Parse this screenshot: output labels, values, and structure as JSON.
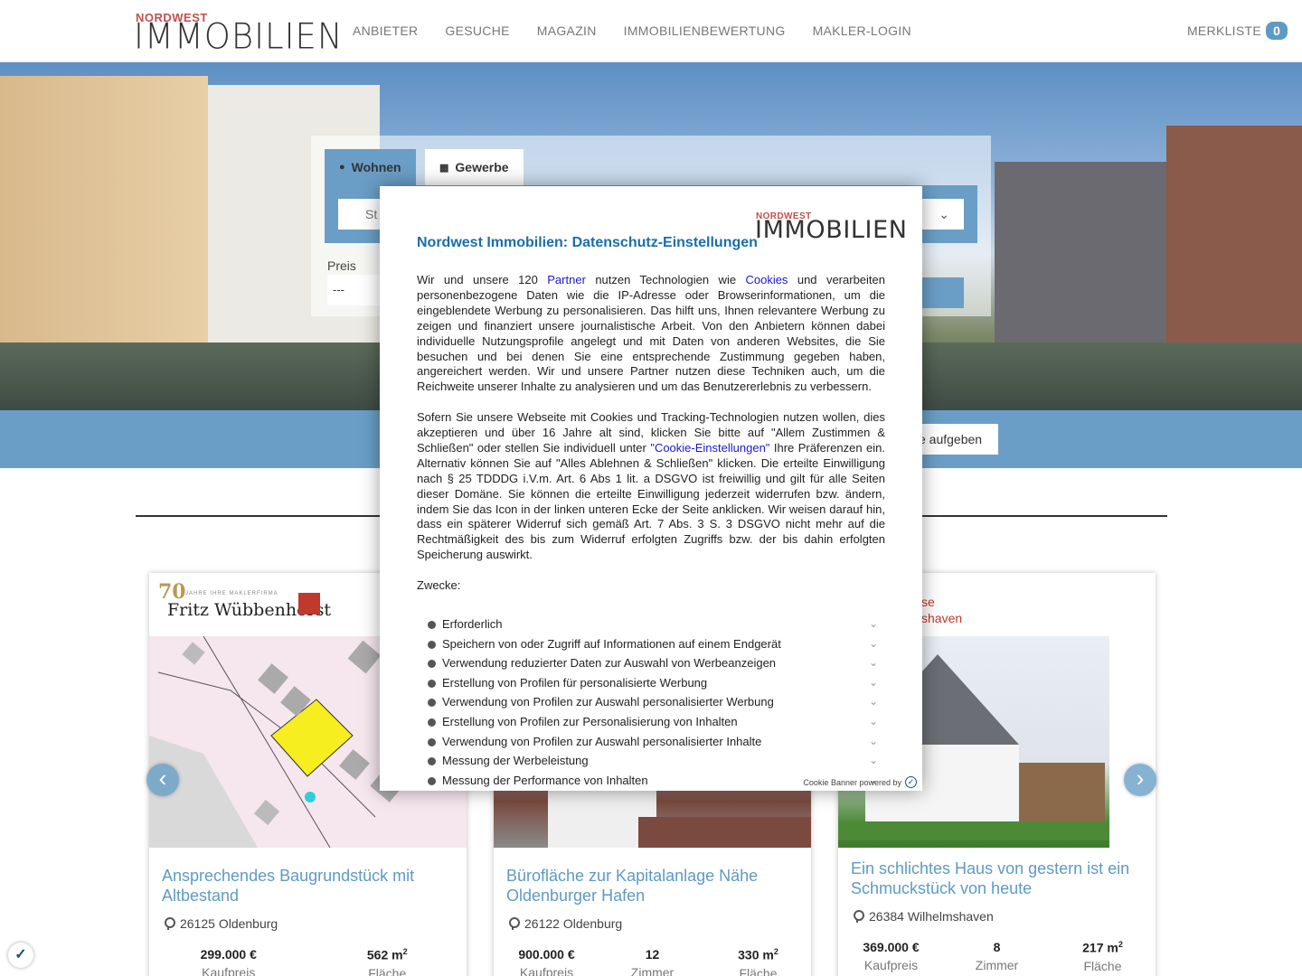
{
  "header": {
    "logo_top": "NORDWEST",
    "logo_main": "IMMOBILIEN",
    "nav": [
      "ANBIETER",
      "GESUCHE",
      "MAGAZIN",
      "IMMOBILIENBEWERTUNG",
      "MAKLER-LOGIN"
    ],
    "merkliste_label": "MERKLISTE",
    "merkliste_count": "0"
  },
  "search": {
    "tab_wohnen": "Wohnen",
    "tab_gewerbe": "Gewerbe",
    "location_placeholder": "St",
    "preis_label": "Preis",
    "preis_value": "---",
    "aufgeben_label": "e aufgeben"
  },
  "modal": {
    "logo_top": "NORDWEST",
    "logo_main": "IMMOBILIEN",
    "title": "Nordwest Immobilien: Datenschutz-Einstellungen",
    "p1_a": "Wir und unsere 120 ",
    "p1_link1": "Partner",
    "p1_b": " nutzen Technologien wie ",
    "p1_link2": "Cookies",
    "p1_c": " und verarbeiten personenbezogene Daten wie die IP-Adresse oder Browserinformationen, um die eingeblendete Werbung zu personalisieren. Das hilft uns, Ihnen relevantere Werbung zu zeigen und finanziert unsere journalistische Arbeit. Von den Anbietern können dabei individuelle Nutzungsprofile angelegt und mit Daten von anderen Websites, die Sie besuchen und bei denen Sie eine entsprechende Zustimmung gegeben haben, angereichert werden. Wir und unsere Partner nutzen diese Techniken auch, um die Reichweite unserer Inhalte zu analysieren und um das Benutzererlebnis zu verbessern.",
    "p2_a": "Sofern Sie unsere Webseite mit Cookies und Tracking-Technologien nutzen wollen, dies akzeptieren und über 16 Jahre alt sind, klicken Sie bitte auf \"Allem Zustimmen & Schließen\" oder stellen Sie individuell unter ",
    "p2_link": "\"Cookie-Einstellungen\"",
    "p2_b": " Ihre Präferenzen ein. Alternativ können Sie auf \"Alles Ablehnen & Schließen\" klicken. Die erteilte Einwilligung nach § 25 TDDDG i.V.m. Art. 6 Abs 1 lit. a DSGVO ist freiwillig und gilt für alle Seiten dieser Domäne. Sie können die erteilte Einwilligung jederzeit widerrufen bzw. ändern, indem Sie das Icon in der linken unteren Ecke der Seite anklicken. Wir weisen darauf hin, dass ein späterer Widerruf sich gemäß Art. 7 Abs. 3 S. 3 DSGVO nicht mehr auf die Rechtmäßigkeit des bis zum Widerruf erfolgten Zugriffs bzw. der bis dahin erfolgten Speicherung auswirkt.",
    "zwecke_label": "Zwecke:",
    "purposes": [
      "Erforderlich",
      "Speichern von oder Zugriff auf Informationen auf einem Endgerät",
      "Verwendung reduzierter Daten zur Auswahl von Werbeanzeigen",
      "Erstellung von Profilen für personalisierte Werbung",
      "Verwendung von Profilen zur Auswahl personalisierter Werbung",
      "Erstellung von Profilen zur Personalisierung von Inhalten",
      "Verwendung von Profilen zur Auswahl personalisierter Inhalte",
      "Messung der Werbeleistung",
      "Messung der Performance von Inhalten"
    ],
    "powered_by": "Cookie Banner powered by"
  },
  "cards": [
    {
      "agent_year": "70",
      "agent_tagline": "JAHRE IHRE MAKLERFIRMA",
      "agent_name": "Fritz Wübbenhorst",
      "title": "Ansprechendes Baugrundstück mit Altbestand",
      "location": "26125 Oldenburg",
      "stats": [
        {
          "value": "299.000 €",
          "label": "Kaufpreis"
        },
        {
          "value": "562 m",
          "sup": "2",
          "label": "Fläche"
        }
      ]
    },
    {
      "title": "Bürofläche zur Kapitalanlage Nähe Oldenburger Hafen",
      "location": "26122 Oldenburg",
      "stats": [
        {
          "value": "900.000 €",
          "label": "Kaufpreis"
        },
        {
          "value": "12",
          "label": "Zimmer"
        },
        {
          "value": "330 m",
          "sup": "2",
          "label": "Fläche"
        }
      ]
    },
    {
      "agent_line1": "se",
      "agent_line2": "shaven",
      "title": "Ein schlichtes Haus von gestern ist ein Schmuckstück von heute",
      "location": "26384 Wilhelmshaven",
      "stats": [
        {
          "value": "369.000 €",
          "label": "Kaufpreis"
        },
        {
          "value": "8",
          "label": "Zimmer"
        },
        {
          "value": "217 m",
          "sup": "2",
          "label": "Fläche"
        }
      ]
    }
  ],
  "icons": {
    "prev": "chevron-left-icon",
    "next": "chevron-right-icon",
    "cookie": "cookie-settings-icon"
  }
}
